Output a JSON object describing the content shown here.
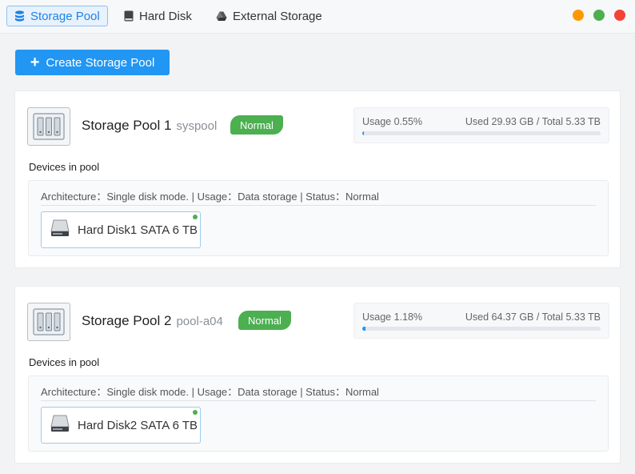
{
  "tabs": [
    {
      "label": "Storage Pool",
      "icon": "database-icon",
      "active": true
    },
    {
      "label": "Hard Disk",
      "icon": "hard-disk-icon",
      "active": false
    },
    {
      "label": "External Storage",
      "icon": "drive-icon",
      "active": false
    }
  ],
  "window_controls": {
    "colors": [
      "#ff9800",
      "#4caf50",
      "#f44336"
    ]
  },
  "create_button": {
    "label": "Create Storage Pool",
    "icon": "plus-icon"
  },
  "pools": [
    {
      "title": "Storage Pool 1",
      "subtitle": "syspool",
      "status": "Normal",
      "usage_label": "Usage 0.55%",
      "usage_percent": 0.55,
      "usage_total": "Used 29.93 GB / Total 5.33 TB",
      "devices_label": "Devices in pool",
      "architecture": "Architecture：Single disk mode. | Usage：Data storage | Status：Normal",
      "disks": [
        {
          "name": "Hard Disk1 SATA 6 TB",
          "status_color": "#4caf50"
        }
      ]
    },
    {
      "title": "Storage Pool 2",
      "subtitle": "pool-a04",
      "status": "Normal",
      "usage_label": "Usage 1.18%",
      "usage_percent": 1.18,
      "usage_total": "Used 64.37 GB / Total 5.33 TB",
      "devices_label": "Devices in pool",
      "architecture": "Architecture：Single disk mode. | Usage：Data storage | Status：Normal",
      "disks": [
        {
          "name": "Hard Disk2 SATA 6 TB",
          "status_color": "#4caf50"
        }
      ]
    }
  ],
  "colors": {
    "accent": "#2196f3",
    "status_normal": "#4caf50"
  }
}
